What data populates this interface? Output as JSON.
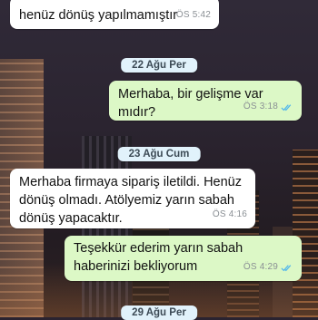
{
  "messages": [
    {
      "id": "m1",
      "direction": "in",
      "text": "henüz dönüş yapılmamıştır",
      "time": "ÖS 5:42"
    },
    {
      "id": "m2",
      "direction": "out",
      "text": "Merhaba, bir gelişme var mıdır?",
      "time": "ÖS 3:18",
      "status": "read"
    },
    {
      "id": "m3",
      "direction": "in",
      "text": "Merhaba firmaya sipariş iletildi. Henüz dönüş olmadı. Atölyemiz yarın sabah dönüş yapacaktır.",
      "time": "ÖS 4:16"
    },
    {
      "id": "m4",
      "direction": "out",
      "text": "Teşekkür ederim yarın sabah haberinizi bekliyorum",
      "time": "ÖS 4:29",
      "status": "read"
    }
  ],
  "date_separators": [
    "22 Ağu Per",
    "23 Ağu Cum",
    "29 Ağu Per"
  ],
  "colors": {
    "incoming_bubble": "#ffffff",
    "outgoing_bubble": "#dcf8c6",
    "read_ticks": "#4fb6ec",
    "date_chip": "#e1f2fb"
  },
  "icons": [
    "double-check-read-icon"
  ]
}
